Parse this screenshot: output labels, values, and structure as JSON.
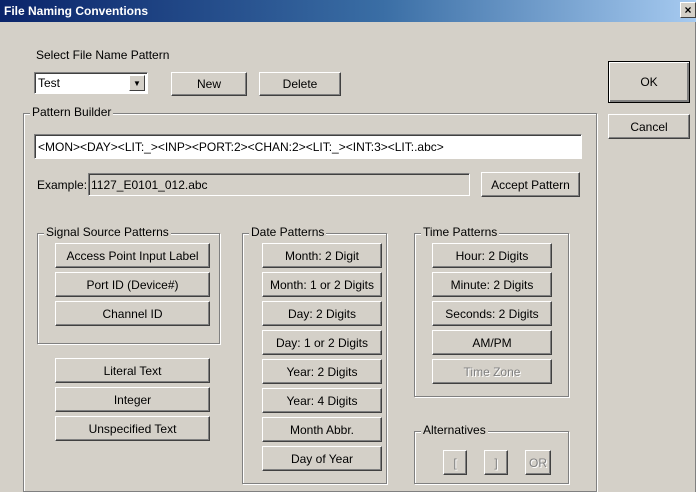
{
  "window": {
    "title": "File Naming Conventions",
    "close_glyph": "×"
  },
  "pattern_select": {
    "label": "Select File Name Pattern",
    "value": "Test",
    "new_label": "New",
    "delete_label": "Delete"
  },
  "dialog_buttons": {
    "ok_label": "OK",
    "cancel_label": "Cancel"
  },
  "builder": {
    "title": "Pattern Builder",
    "pattern": "<MON><DAY><LIT:_><INP><PORT:2><CHAN:2><LIT:_><INT:3><LIT:.abc>",
    "example_label": "Example:",
    "example_value": "1127_E0101_012.abc",
    "accept_label": "Accept Pattern"
  },
  "signal_source": {
    "title": "Signal Source Patterns",
    "items": [
      "Access Point Input Label",
      "Port ID (Device#)",
      "Channel ID"
    ]
  },
  "misc_buttons": [
    "Literal Text",
    "Integer",
    "Unspecified Text"
  ],
  "date_patterns": {
    "title": "Date Patterns",
    "items": [
      "Month: 2 Digit",
      "Month: 1 or 2 Digits",
      "Day: 2 Digits",
      "Day: 1 or 2 Digits",
      "Year: 2 Digits",
      "Year: 4 Digits",
      "Month Abbr.",
      "Day of Year"
    ]
  },
  "time_patterns": {
    "title": "Time Patterns",
    "items": [
      "Hour: 2 Digits",
      "Minute: 2 Digits",
      "Seconds: 2 Digits",
      "AM/PM",
      "Time Zone"
    ]
  },
  "alternatives": {
    "title": "Alternatives",
    "items": [
      "[",
      "]",
      "OR"
    ]
  }
}
